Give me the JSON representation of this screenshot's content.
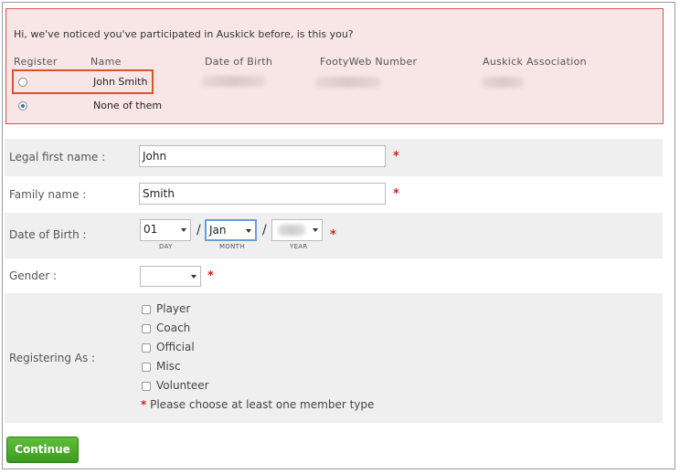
{
  "notice": {
    "message": "Hi, we've noticed you've participated in Auskick before, is this you?",
    "headers": {
      "register": "Register",
      "name": "Name",
      "dob": "Date of Birth",
      "footyweb": "FootyWeb Number",
      "association": "Auskick Association"
    },
    "candidates": [
      {
        "name": "John Smith",
        "selected": false
      },
      {
        "name": "None of them",
        "selected": true
      }
    ]
  },
  "form": {
    "first_name": {
      "label": "Legal first name :",
      "value": "John"
    },
    "family_name": {
      "label": "Family name :",
      "value": "Smith"
    },
    "dob": {
      "label": "Date of Birth :",
      "day": "01",
      "month": "Jan",
      "year": "",
      "day_caption": "DAY",
      "month_caption": "MONTH",
      "year_caption": "YEAR",
      "separator": "/"
    },
    "gender": {
      "label": "Gender :",
      "value": ""
    },
    "registering_as": {
      "label": "Registering As :",
      "options": [
        "Player",
        "Coach",
        "Official",
        "Misc",
        "Volunteer"
      ],
      "note_star": "*",
      "note": "Please choose at least one member type"
    },
    "required_marker": "*"
  },
  "actions": {
    "continue": "Continue"
  },
  "colors": {
    "accent_green": "#4caf2b",
    "required_red": "#d42020",
    "notice_bg": "#f8e6e6"
  }
}
